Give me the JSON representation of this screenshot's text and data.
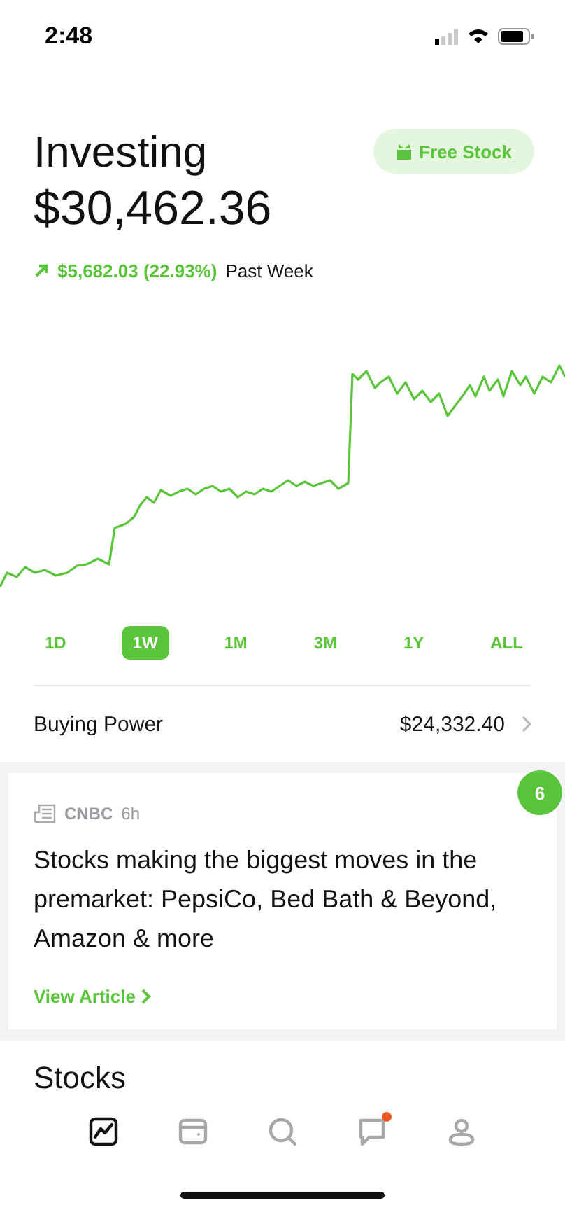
{
  "status_bar": {
    "time": "2:48"
  },
  "header": {
    "title": "Investing",
    "value": "$30,462.36",
    "free_stock": "Free Stock",
    "change": "$5,682.03 (22.93%)",
    "period": "Past Week"
  },
  "ranges": [
    {
      "label": "1D",
      "selected": false
    },
    {
      "label": "1W",
      "selected": true
    },
    {
      "label": "1M",
      "selected": false
    },
    {
      "label": "3M",
      "selected": false
    },
    {
      "label": "1Y",
      "selected": false
    },
    {
      "label": "ALL",
      "selected": false
    }
  ],
  "buying_power": {
    "label": "Buying Power",
    "value": "$24,332.40"
  },
  "news": {
    "count": "6",
    "source": "CNBC",
    "age": "6h",
    "headline": "Stocks making the biggest moves in the premarket: PepsiCo, Bed Bath & Beyond, Amazon & more",
    "link": "View Article"
  },
  "section_title": "Stocks",
  "nav": [
    {
      "kind": "chart",
      "selected": true,
      "badge": false
    },
    {
      "kind": "wallet",
      "selected": false,
      "badge": false
    },
    {
      "kind": "search",
      "selected": false,
      "badge": false
    },
    {
      "kind": "chat",
      "selected": false,
      "badge": true
    },
    {
      "kind": "profile",
      "selected": false,
      "badge": false
    }
  ]
}
